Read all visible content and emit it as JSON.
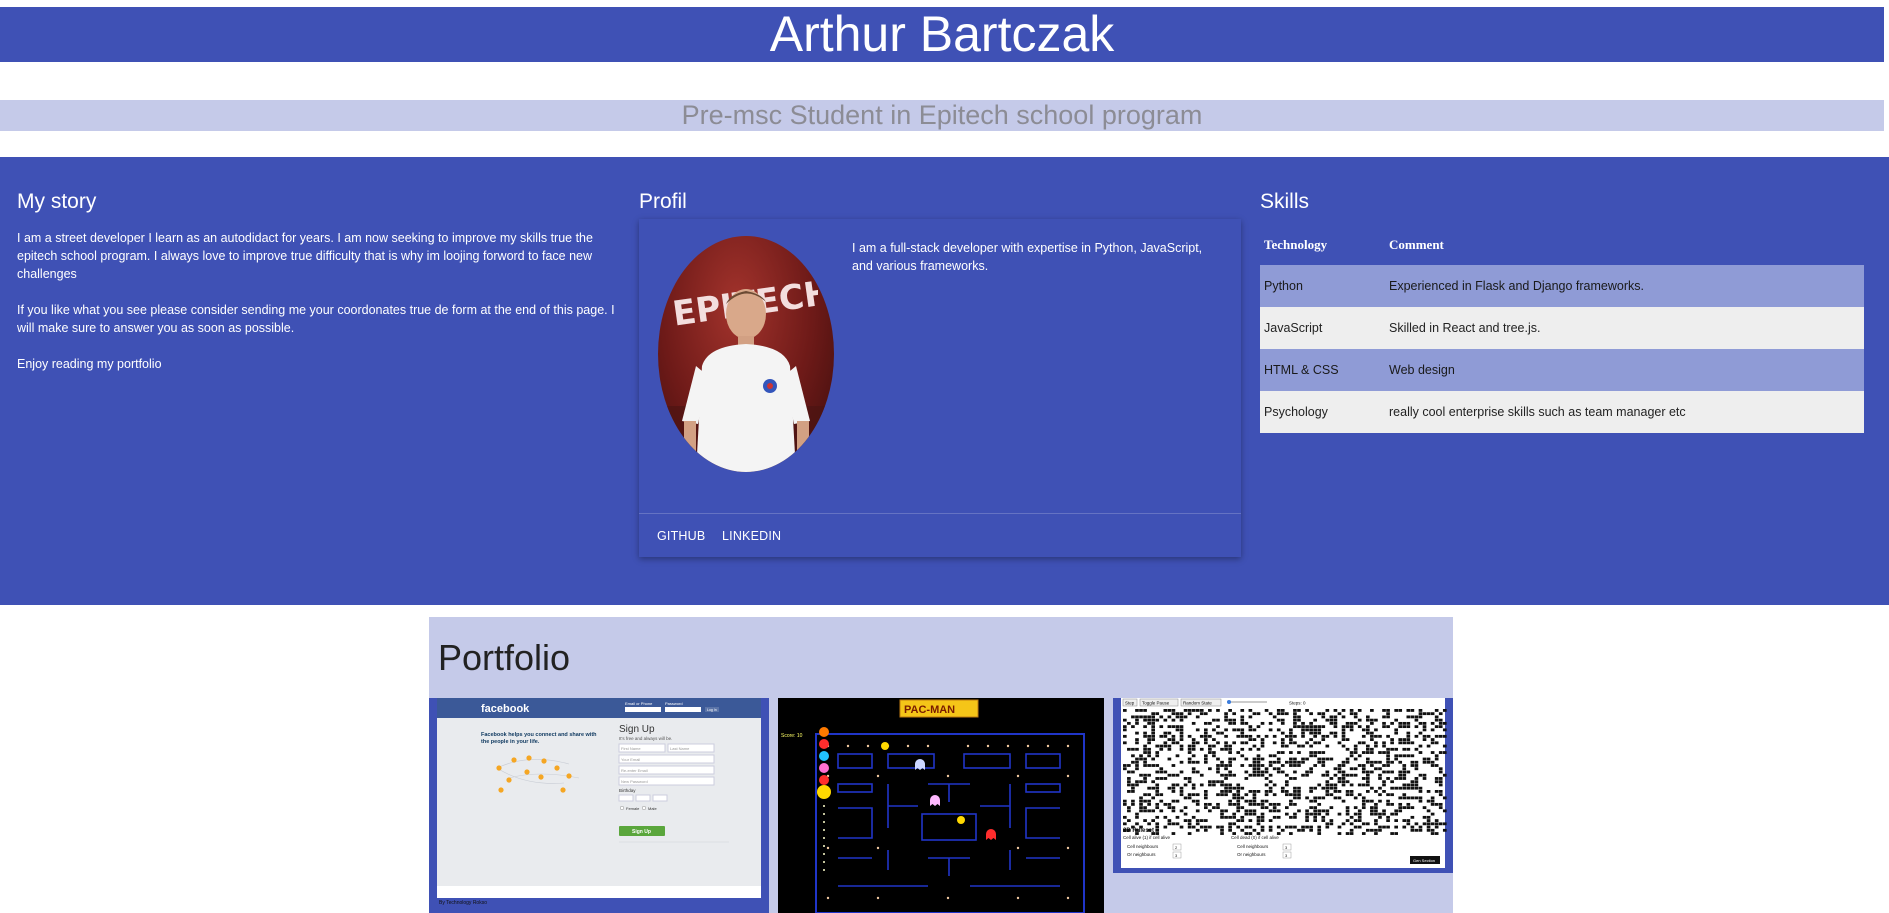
{
  "header": {
    "name": "Arthur Bartczak"
  },
  "subheader": {
    "tagline": "Pre-msc Student in Epitech school program"
  },
  "story": {
    "title": "My story",
    "paragraphs": [
      "I am a street developer I learn as an autodidact for years. I am now seeking to improve my skills true the epitech school program. I always love to improve true difficulty that is why im loojing forword to face new challenges",
      "If you like what you see please consider sending me your coordonates true de form at the end of this page. I will make sure to answer you as soon as possible.",
      "Enjoy reading my portfolio"
    ]
  },
  "profil": {
    "title": "Profil",
    "description": "I am a full-stack developer with expertise in Python, JavaScript, and various frameworks.",
    "photo_logo_text": "EPITECH.",
    "links": [
      "GITHUB",
      "LINKEDIN"
    ]
  },
  "skills": {
    "title": "Skills",
    "headers": [
      "Technology",
      "Comment"
    ],
    "rows": [
      [
        "Python",
        "Experienced in Flask and Django frameworks."
      ],
      [
        "JavaScript",
        "Skilled in React and tree.js."
      ],
      [
        "HTML & CSS",
        "Web design"
      ],
      [
        "Psychology",
        "really cool enterprise skills such as team manager etc"
      ]
    ]
  },
  "portfolio": {
    "title": "Portfolio",
    "facebook": {
      "brand": "facebook",
      "tagline": "Facebook helps you connect and share with the people in your life.",
      "signup_title": "Sign Up",
      "signup_sub": "It's free and always will be.",
      "fields": [
        "First Name",
        "Last Name",
        "Your Email",
        "Re-enter Email",
        "New Password"
      ],
      "birthday_label": "Birthday",
      "gender": [
        "Female",
        "Male"
      ],
      "signup_button": "Sign Up",
      "login": [
        "Email or Phone",
        "Password",
        "Log In"
      ],
      "footer": "By Technology Rokso"
    },
    "pacman": {
      "title": "PAC-MAN",
      "score_label": "Score: 10"
    },
    "life": {
      "buttons": [
        "Step",
        "Toggle Pause",
        "Random State"
      ],
      "steps_label": "Steps: 0",
      "ruleset_title": "2D Ruleset",
      "alive_label": "Cell alive (1) if cell alive",
      "dead_label": "Cell dead (0) if cell alive",
      "neighbours_label": "Cell neighbours",
      "or_neighbours_label": "Or neighbours",
      "alive_values": [
        "2",
        "3"
      ],
      "dead_values": [
        "3",
        "3"
      ],
      "button": "Gen Section"
    }
  },
  "colors": {
    "primary": "#3f51b5",
    "light": "#c5cae9",
    "row_odd": "#8f9bd6",
    "row_even": "#eeeeee"
  }
}
